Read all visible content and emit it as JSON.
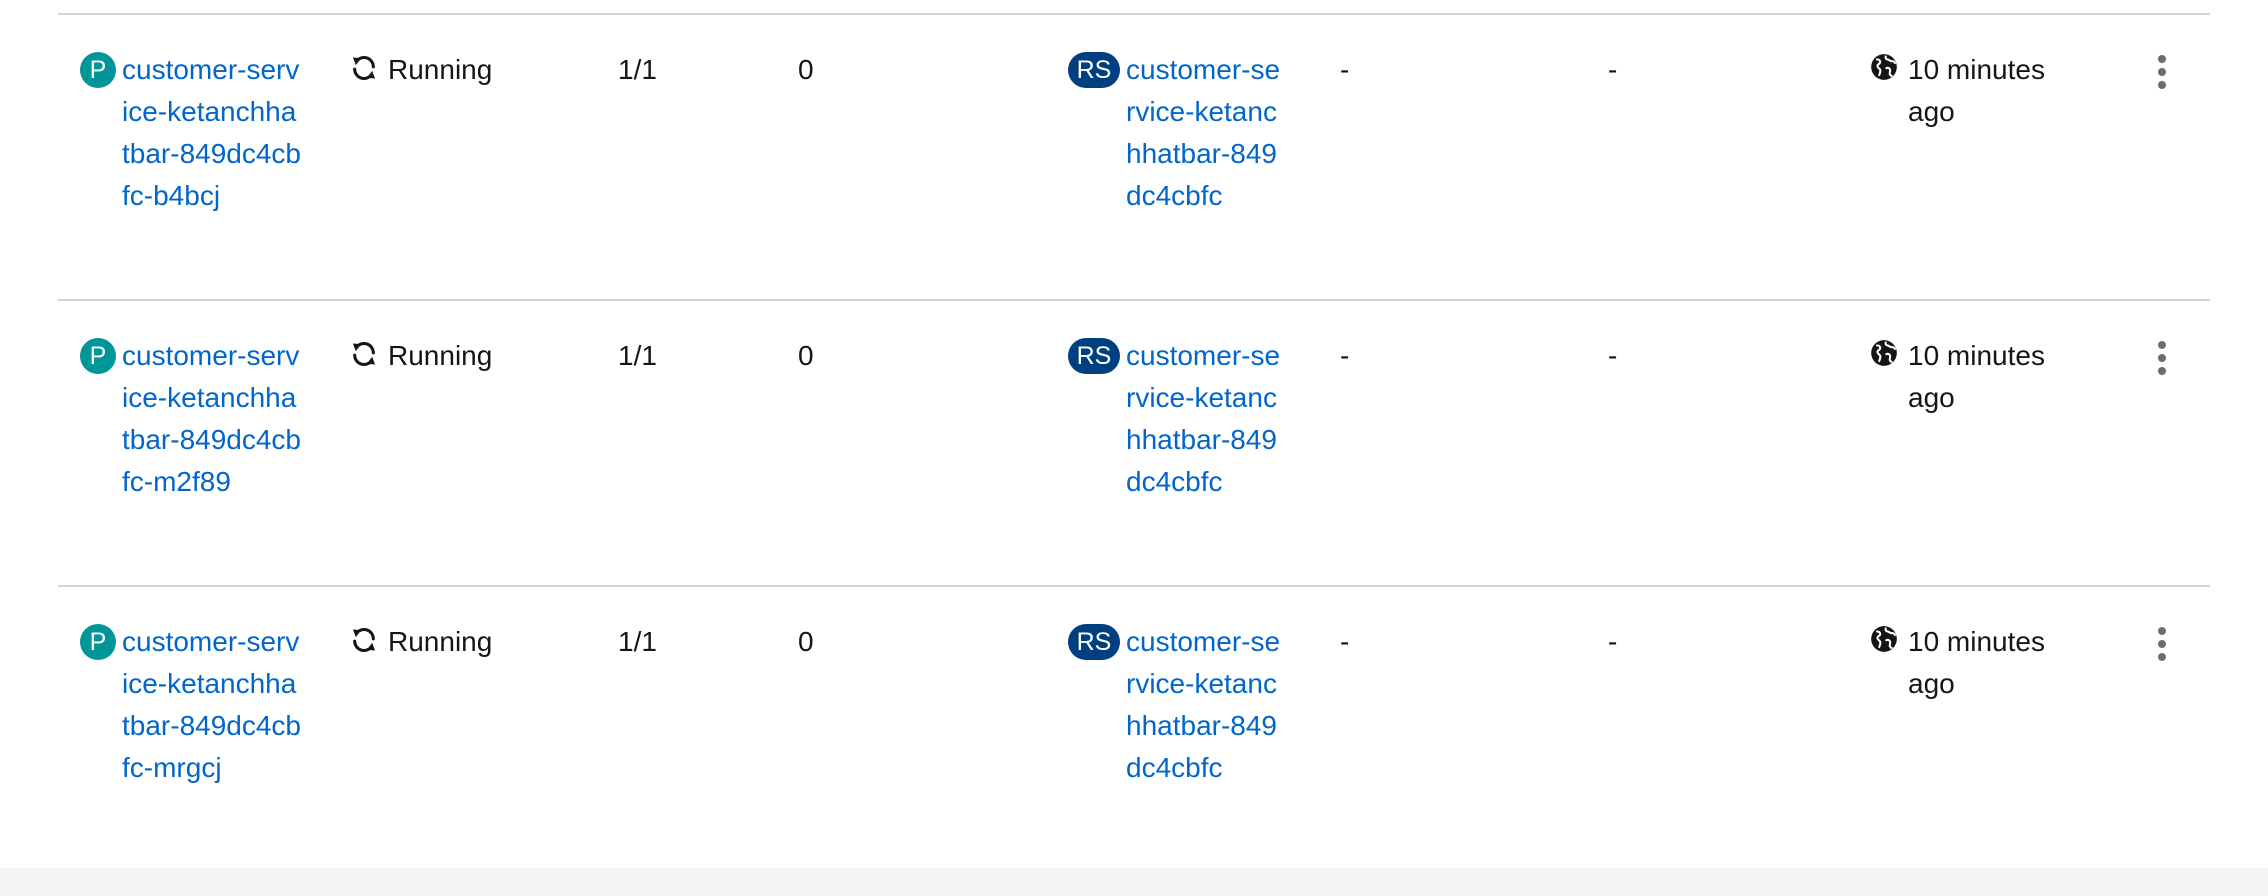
{
  "rows": [
    {
      "badge": "P",
      "name": "customer-service-ketanchhatbar-849dc4cbfc-b4bcj",
      "status": "Running",
      "ready": "1/1",
      "restarts": "0",
      "owner_badge": "RS",
      "owner": "customer-service-ketanchhatbar-849dc4cbfc",
      "memory": "-",
      "cpu": "-",
      "created": "10 minutes ago"
    },
    {
      "badge": "P",
      "name": "customer-service-ketanchhatbar-849dc4cbfc-m2f89",
      "status": "Running",
      "ready": "1/1",
      "restarts": "0",
      "owner_badge": "RS",
      "owner": "customer-service-ketanchhatbar-849dc4cbfc",
      "memory": "-",
      "cpu": "-",
      "created": "10 minutes ago"
    },
    {
      "badge": "P",
      "name": "customer-service-ketanchhatbar-849dc4cbfc-mrgcj",
      "status": "Running",
      "ready": "1/1",
      "restarts": "0",
      "owner_badge": "RS",
      "owner": "customer-service-ketanchhatbar-849dc4cbfc",
      "memory": "-",
      "cpu": "-",
      "created": "10 minutes ago"
    }
  ],
  "icons": {
    "status": "sync-icon",
    "created": "globe-icon",
    "actions": "kebab-menu-icon"
  },
  "colors": {
    "link": "#0066cc",
    "pod_badge": "#009596",
    "replicaset_badge": "#004080",
    "border": "#d2d2d2"
  }
}
